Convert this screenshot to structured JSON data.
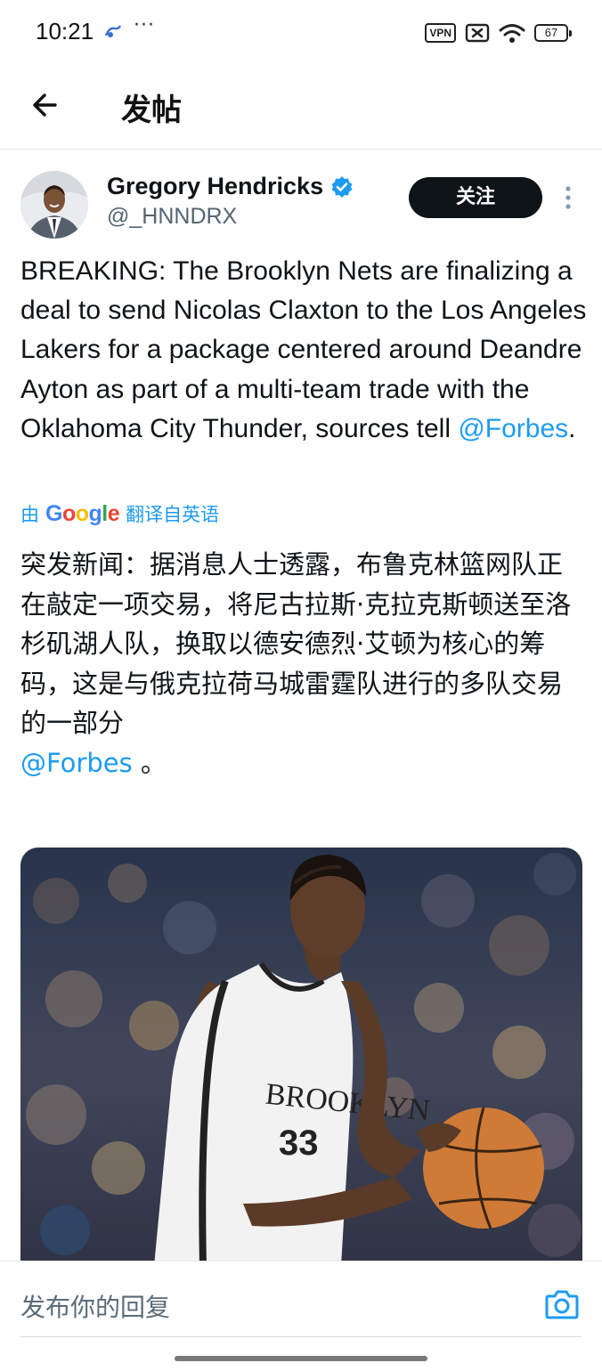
{
  "status_bar": {
    "time": "10:21",
    "overflow_dots": "···",
    "vpn_label": "VPN",
    "battery_level": "67"
  },
  "header": {
    "title": "发帖"
  },
  "post": {
    "author": {
      "name": "Gregory Hendricks",
      "handle": "@_HNNDRX",
      "verified": true
    },
    "follow_label": "关注",
    "text_main": "BREAKING: The Brooklyn Nets are finalizing a deal to send Nicolas Claxton to the Los Angeles Lakers for a package centered around Deandre Ayton as part of a multi-team trade with the Oklahoma City Thunder, sources tell ",
    "text_mention": "@Forbes",
    "text_end": ".",
    "translation": {
      "by_label": "由",
      "provider": "Google",
      "action_label": "翻译自英语",
      "text": "突发新闻：据消息人士透露，布鲁克林篮网队正在敲定一项交易，将尼古拉斯·克拉克斯顿送至洛杉矶湖人队，换取以德安德烈·艾顿为核心的筹码，这是与俄克拉荷马城雷霆队进行的多队交易的一部分",
      "mention": "@Forbes",
      "end": " 。"
    },
    "media": {
      "jersey_text": "BROOKLYN",
      "jersey_number": "33"
    }
  },
  "reply": {
    "placeholder": "发布你的回复"
  },
  "colors": {
    "accent": "#1d9bf0",
    "text": "#0f1419",
    "secondary": "#536471",
    "follow_bg": "#0f1419"
  },
  "icons": {
    "back": "arrow-left-icon",
    "verified": "verified-badge-icon",
    "more": "more-vertical-icon",
    "camera": "camera-icon",
    "wifi": "wifi-icon",
    "sim": "no-sim-icon"
  }
}
